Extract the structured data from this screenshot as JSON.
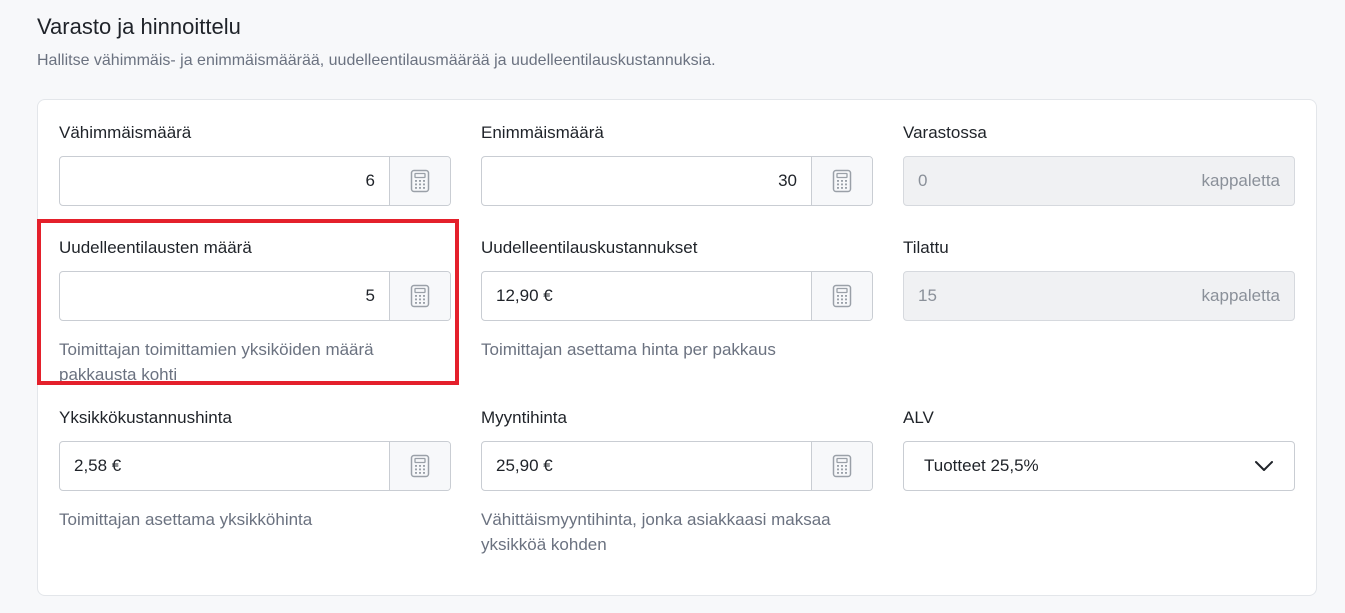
{
  "section": {
    "title": "Varasto ja hinnoittelu",
    "subtitle": "Hallitse vähimmäis- ja enimmäismäärää, uudelleentilausmäärää ja uudelleentilauskustannuksia."
  },
  "fields": {
    "min_qty": {
      "label": "Vähimmäismäärä",
      "value": "6"
    },
    "max_qty": {
      "label": "Enimmäismäärä",
      "value": "30"
    },
    "in_stock": {
      "label": "Varastossa",
      "value": "0",
      "unit": "kappaletta"
    },
    "reorder_qty": {
      "label": "Uudelleentilausten määrä",
      "value": "5",
      "help": "Toimittajan toimittamien yksiköiden määrä pakkausta kohti"
    },
    "reorder_cost": {
      "label": "Uudelleentilauskustannukset",
      "value": "12,90 €",
      "help": "Toimittajan asettama hinta per pakkaus"
    },
    "ordered": {
      "label": "Tilattu",
      "value": "15",
      "unit": "kappaletta"
    },
    "unit_cost": {
      "label": "Yksikkökustannushinta",
      "value": "2,58 €",
      "help": "Toimittajan asettama yksikköhinta"
    },
    "sale_price": {
      "label": "Myyntihinta",
      "value": "25,90 €",
      "help": "Vähittäismyyntihinta, jonka asiakkaasi maksaa yksikköä kohden"
    },
    "vat": {
      "label": "ALV",
      "selected": "Tuotteet 25,5%"
    }
  },
  "icons": {
    "calculator": "calculator-icon",
    "dropdown": "chevron-down-icon"
  },
  "colors": {
    "highlight": "#e4202b",
    "border": "#c9cdd3",
    "readonly_bg": "#f0f1f3",
    "muted_text": "#6b7280"
  }
}
